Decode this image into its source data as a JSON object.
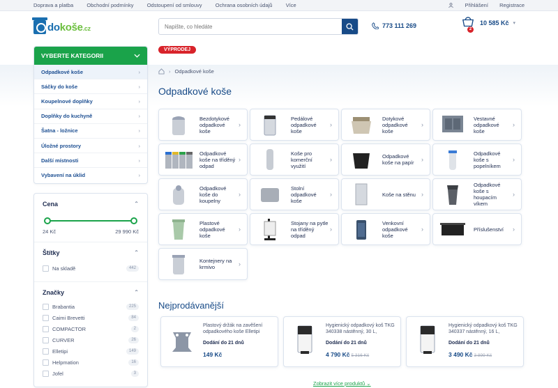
{
  "topbar": {
    "links": [
      "Doprava a platba",
      "Obchodní podmínky",
      "Odstoupení od smlouvy",
      "Ochrana osobních údajů",
      "Více"
    ],
    "login": "Přihlášení",
    "register": "Registrace"
  },
  "header": {
    "logo_main": "do",
    "logo_green": "koše",
    "logo_tld": ".cz",
    "search_placeholder": "Napište, co hledáte",
    "phone": "773 111 269",
    "cart_count": "2",
    "cart_total": "10 585 Kč"
  },
  "sidebar": {
    "title": "VYBERTE KATEGORII",
    "categories": [
      "Odpadkové koše",
      "Sáčky do koše",
      "Koupelnové doplňky",
      "Doplňky do kuchyně",
      "Šatna - ložnice",
      "Úložné prostory",
      "Další místnosti",
      "Vybavení na úklid"
    ],
    "price_title": "Cena",
    "price_min": "24 Kč",
    "price_max": "29 990 Kč",
    "tags_title": "Štítky",
    "tags": [
      {
        "label": "Na skladě",
        "count": "442"
      }
    ],
    "brands_title": "Značky",
    "brands": [
      {
        "label": "Brabantia",
        "count": "225"
      },
      {
        "label": "Caimi Brevetti",
        "count": "84"
      },
      {
        "label": "COMPACTOR",
        "count": "2"
      },
      {
        "label": "CURVER",
        "count": "26"
      },
      {
        "label": "Elletipi",
        "count": "149"
      },
      {
        "label": "Helpmation",
        "count": "16"
      },
      {
        "label": "Jofel",
        "count": "3"
      }
    ]
  },
  "main": {
    "sale_badge": "VÝPRODEJ",
    "breadcrumb": "Odpadkové koše",
    "title": "Odpadkové koše",
    "tiles": [
      "Bezdotykové odpadkové koše",
      "Pedálové odpadkové koše",
      "Dotykové odpadkové koše",
      "Vestavné odpadkové koše",
      "Odpadkové koše na tříděný odpad",
      "Koše pro komerční využití",
      "Odpadkové koše na papír",
      "Odpadkové koše s popelníkem",
      "Odpadkové koše do koupelny",
      "Stolní odpadkové koše",
      "Koše na stěnu",
      "Odpadkové koše s houpacím víkem",
      "Plastové odpadkové koše",
      "Stojany na pytle na tříděný odpad",
      "Venkovní odpadkové koše",
      "Příslušenství",
      "Kontejnery na krmivo"
    ],
    "bestsellers_title": "Nejprodávanější",
    "products": [
      {
        "name": "Plastový držák na zavěšení odpadkového koše Elletipi",
        "delivery": "Dodání do 21 dnů",
        "price": "149 Kč",
        "old": ""
      },
      {
        "name": "Hygienický odpadkový koš TKG 340338 nástěnný, 30 L,",
        "delivery": "Dodání do 21 dnů",
        "price": "4 790 Kč",
        "old": "5 316 Kč"
      },
      {
        "name": "Hygienický odpadkový koš TKG 340337 nástěnný, 16 L,",
        "delivery": "Dodání do 21 dnů",
        "price": "3 490 Kč",
        "old": "3 899 Kč"
      }
    ],
    "more_link": "Zobrazit více produktů"
  },
  "colors": {
    "brand_blue": "#174a87",
    "green": "#1aa34a",
    "sale_red": "#d8232a"
  }
}
